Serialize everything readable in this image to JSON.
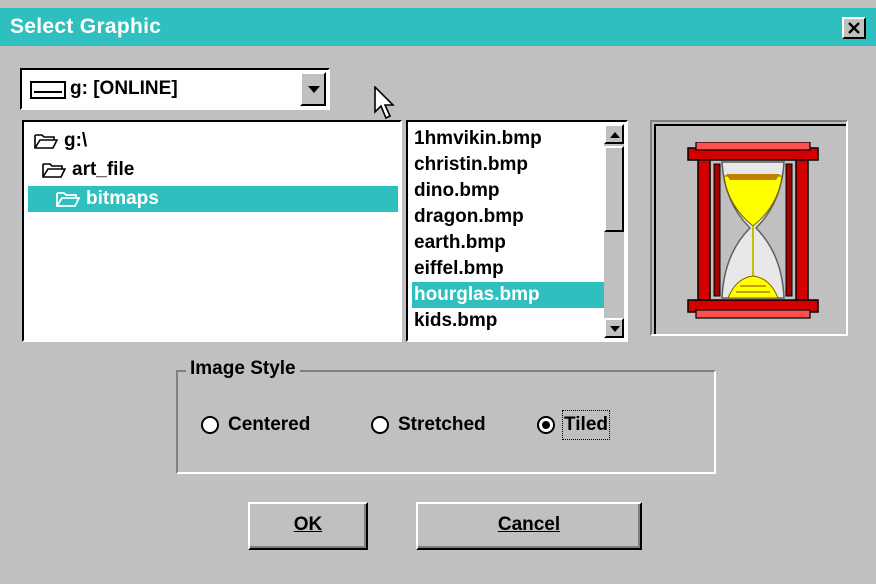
{
  "window": {
    "title": "Select Graphic",
    "close_label": "×"
  },
  "drive_select": {
    "value": "g: [ONLINE]",
    "icon": "drive-icon"
  },
  "directories": [
    {
      "label": "g:\\",
      "icon": "open-folder-icon",
      "selected": false
    },
    {
      "label": "art_file",
      "icon": "open-folder-icon",
      "selected": false
    },
    {
      "label": "bitmaps",
      "icon": "open-folder-icon",
      "selected": true
    }
  ],
  "files": [
    {
      "label": "1hmvikin.bmp",
      "selected": false
    },
    {
      "label": "christin.bmp",
      "selected": false
    },
    {
      "label": "dino.bmp",
      "selected": false
    },
    {
      "label": "dragon.bmp",
      "selected": false
    },
    {
      "label": "earth.bmp",
      "selected": false
    },
    {
      "label": "eiffel.bmp",
      "selected": false
    },
    {
      "label": "hourglas.bmp",
      "selected": true
    },
    {
      "label": "kids.bmp",
      "selected": false
    }
  ],
  "preview": {
    "icon": "hourglass-icon"
  },
  "image_style": {
    "legend": "Image Style",
    "options": [
      {
        "label": "Centered",
        "checked": false
      },
      {
        "label": "Stretched",
        "checked": false
      },
      {
        "label": "Tiled",
        "checked": true
      }
    ]
  },
  "buttons": {
    "ok": {
      "label": "OK"
    },
    "cancel": {
      "label": "Cancel"
    }
  },
  "colors": {
    "selection": "#2fbfbf",
    "titlebar": "#2fbfbf",
    "face": "#c0c0c0"
  }
}
